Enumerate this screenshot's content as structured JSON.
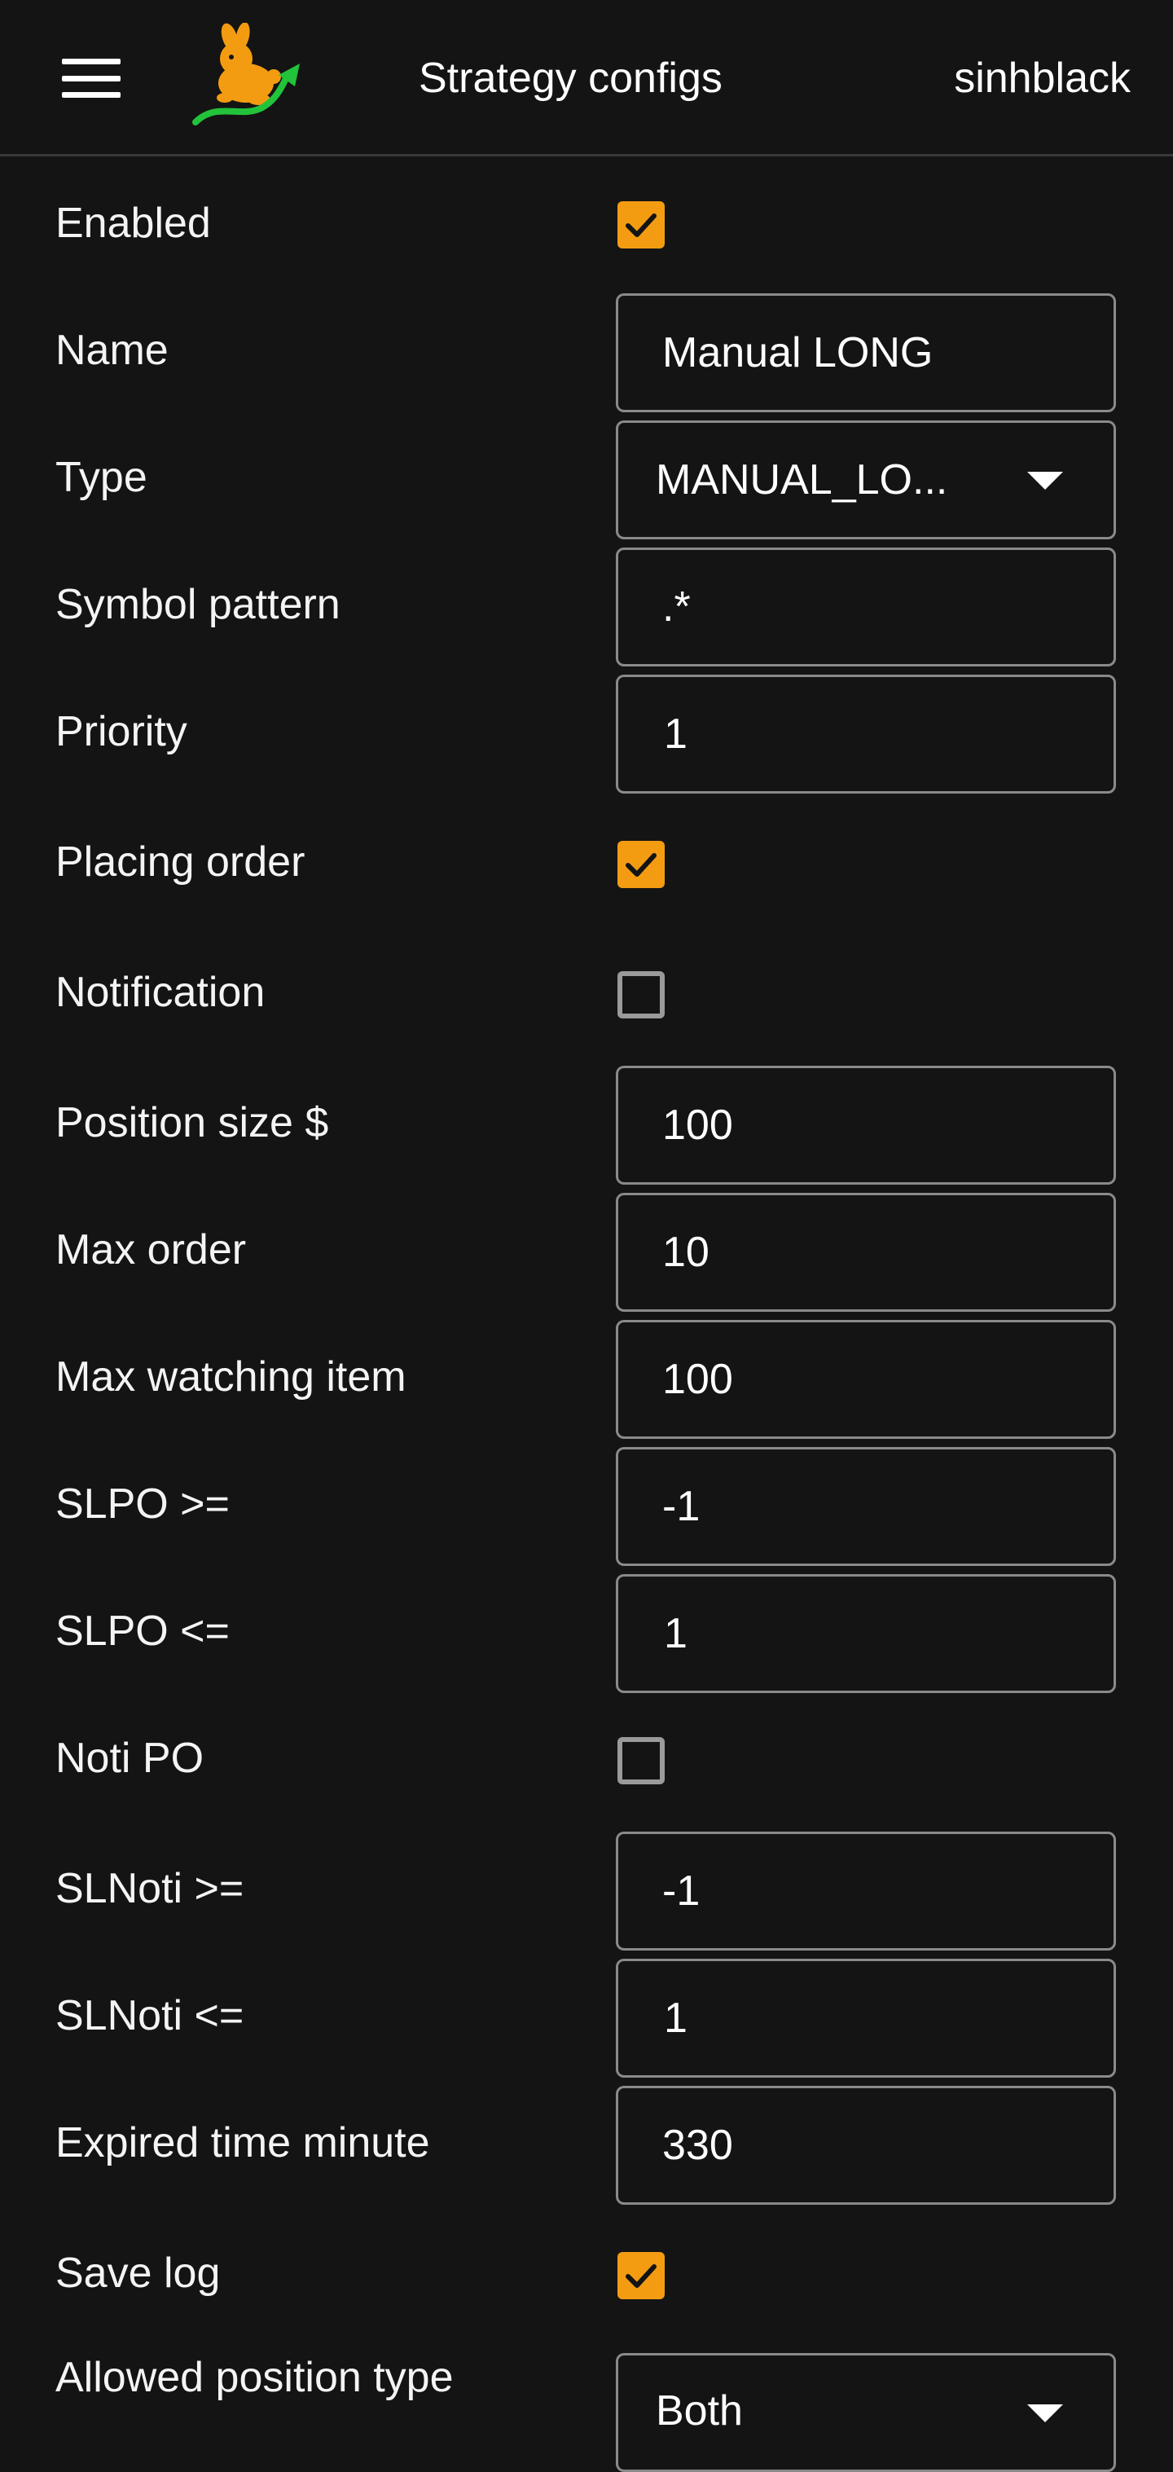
{
  "header": {
    "menu_icon": "hamburger-menu-icon",
    "logo_icon": "rabbit-logo-icon",
    "title": "Strategy configs",
    "username": "sinhblack"
  },
  "colors": {
    "background": "#141414",
    "accent": "#f39c12",
    "field_border": "#8a8a8a"
  },
  "form": {
    "enabled": {
      "label": "Enabled",
      "checked": true
    },
    "name": {
      "label": "Name",
      "value": "Manual LONG"
    },
    "type": {
      "label": "Type",
      "value": "MANUAL_LO..."
    },
    "symbol_pattern": {
      "label": "Symbol pattern",
      "value": ".*"
    },
    "priority": {
      "label": "Priority",
      "value": "1"
    },
    "placing_order": {
      "label": "Placing order",
      "checked": true
    },
    "notification": {
      "label": "Notification",
      "checked": false
    },
    "position_size": {
      "label": "Position size $",
      "value": "100"
    },
    "max_order": {
      "label": "Max order",
      "value": "10"
    },
    "max_watching_item": {
      "label": "Max watching item",
      "value": "100"
    },
    "slpo_gte": {
      "label": "SLPO >=",
      "value": "-1"
    },
    "slpo_lte": {
      "label": "SLPO <=",
      "value": "1"
    },
    "noti_po": {
      "label": "Noti PO",
      "checked": false
    },
    "slnoti_gte": {
      "label": "SLNoti >=",
      "value": "-1"
    },
    "slnoti_lte": {
      "label": "SLNoti <=",
      "value": "1"
    },
    "expired_time_minute": {
      "label": "Expired time minute",
      "value": "330"
    },
    "save_log": {
      "label": "Save log",
      "checked": true
    },
    "allowed_position_type": {
      "label": "Allowed position type",
      "value": "Both"
    }
  }
}
